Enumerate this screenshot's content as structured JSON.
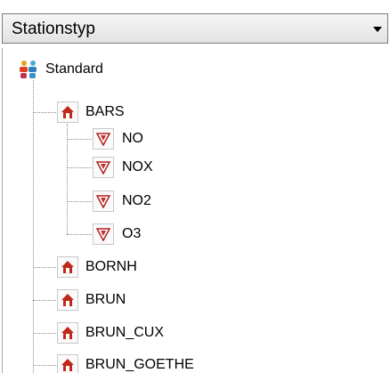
{
  "dropdown": {
    "selected": "Stationstyp"
  },
  "tree": {
    "root": {
      "label": "Standard",
      "icon": "group-icon"
    },
    "stations": [
      {
        "label": "BARS",
        "icon": "house-icon",
        "expanded": true,
        "children": [
          {
            "label": "NO",
            "icon": "component-icon"
          },
          {
            "label": "NOX",
            "icon": "component-icon"
          },
          {
            "label": "NO2",
            "icon": "component-icon"
          },
          {
            "label": "O3",
            "icon": "component-icon"
          }
        ]
      },
      {
        "label": "BORNH",
        "icon": "house-icon"
      },
      {
        "label": "BRUN",
        "icon": "house-icon"
      },
      {
        "label": "BRUN_CUX",
        "icon": "house-icon"
      },
      {
        "label": "BRUN_GOETHE",
        "icon": "house-icon"
      }
    ]
  },
  "colors": {
    "house": "#c0281c",
    "tree_lines": "#8a8a8a"
  }
}
